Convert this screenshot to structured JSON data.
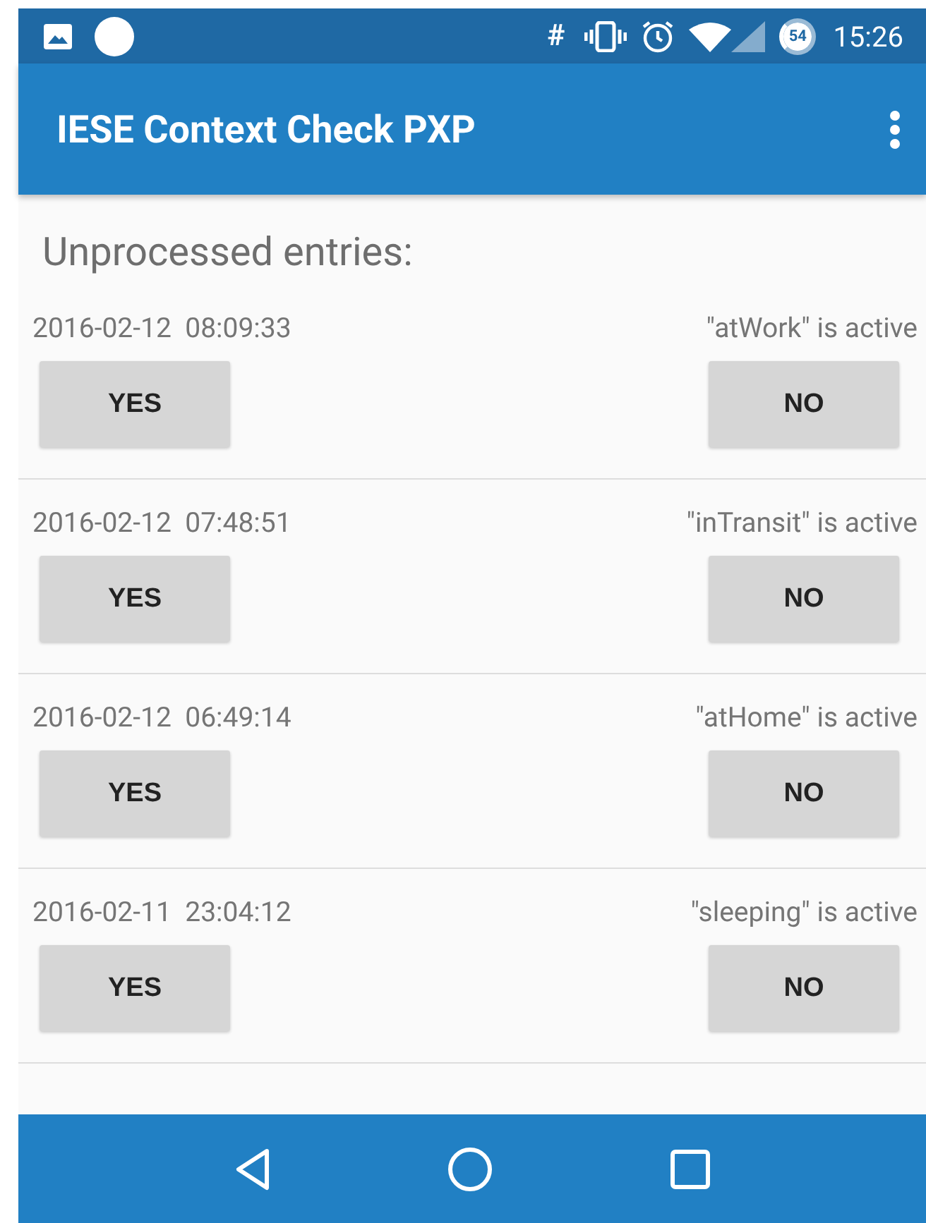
{
  "status_bar": {
    "hash": "#",
    "battery_percent": "54",
    "time": "15:26"
  },
  "app_bar": {
    "title": "IESE Context Check PXP"
  },
  "heading": "Unprocessed entries:",
  "entries": [
    {
      "timestamp": "2016-02-12  08:09:33",
      "context": "\"atWork\" is active",
      "yes": "YES",
      "no": "NO"
    },
    {
      "timestamp": "2016-02-12  07:48:51",
      "context": "\"inTransit\" is active",
      "yes": "YES",
      "no": "NO"
    },
    {
      "timestamp": "2016-02-12  06:49:14",
      "context": "\"atHome\" is active",
      "yes": "YES",
      "no": "NO"
    },
    {
      "timestamp": "2016-02-11  23:04:12",
      "context": "\"sleeping\" is active",
      "yes": "YES",
      "no": "NO"
    }
  ]
}
